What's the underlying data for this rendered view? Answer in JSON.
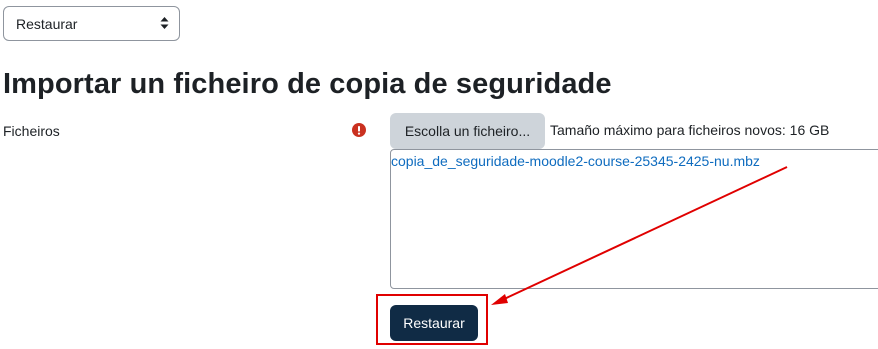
{
  "restore_select": {
    "selected": "Restaurar"
  },
  "page_title": "Importar un ficheiro de copia de seguridade",
  "form": {
    "files_label": "Ficheiros",
    "choose_file_label": "Escolla un ficheiro...",
    "max_size_text": "Tamaño máximo para ficheiros novos: 16 GB",
    "uploaded_file": "copia_de_seguridade-moodle2-course-25345-2425-nu.mbz",
    "submit_label": "Restaurar"
  },
  "colors": {
    "submit_bg": "#102b45",
    "link": "#0f6cbf",
    "required": "#ca3120",
    "annotation": "#e00000"
  },
  "icons": {
    "select_caret": "sort-caret-icon",
    "required": "exclamation-circle-icon"
  }
}
